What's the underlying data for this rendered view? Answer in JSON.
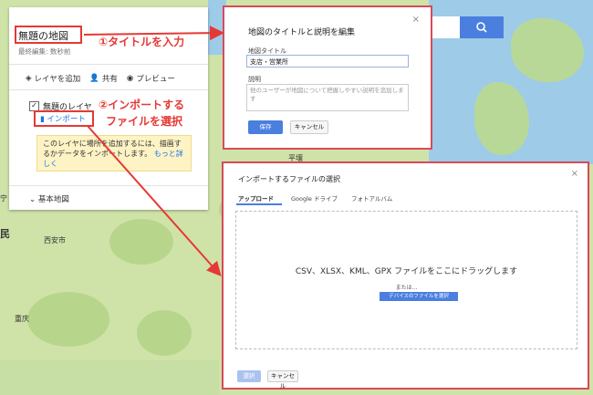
{
  "sidebar": {
    "map_title": "無題の地図",
    "last_edit": "最終編集: 数秒前",
    "add_layer": "レイヤを追加",
    "share": "共有",
    "preview": "プレビュー",
    "layer_name": "無題のレイヤ",
    "import_link": "インポート",
    "hint_text": "このレイヤに場所を追加するには、描画するかデータをインポートします。",
    "hint_more": "もっと詳しく",
    "base_map": "基本地図"
  },
  "annotations": {
    "step1": "①タイトルを入力",
    "step2_line1": "②インポートする",
    "step2_line2": "ファイルを選択"
  },
  "edit_dialog": {
    "title": "地図のタイトルと説明を編集",
    "title_label": "地図タイトル",
    "title_value": "支店・営業所",
    "desc_label": "説明",
    "desc_placeholder": "他のユーザーが地図について把握しやすい説明を追加します",
    "save": "保存",
    "cancel": "キャンセル"
  },
  "import_dialog": {
    "title": "インポートするファイルの選択",
    "tabs": [
      "アップロード",
      "Google ドライブ",
      "フォトアルバム"
    ],
    "drop_text": "CSV、XLSX、KML、GPX ファイルをここにドラッグします",
    "or_text": "または...",
    "select_button": "デバイスのファイルを選択",
    "select": "選択",
    "cancel": "キャンセル"
  },
  "map_labels": [
    "平壤",
    "西安市",
    "重庆",
    "宁",
    "民"
  ],
  "colors": {
    "accent": "#e53935",
    "primary_button": "#4a7fe0",
    "link": "#1a73e8"
  }
}
